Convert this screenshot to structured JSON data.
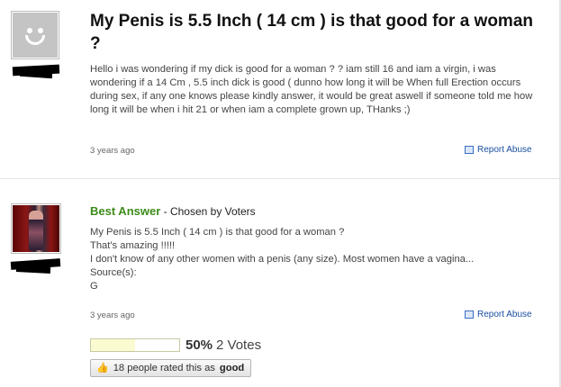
{
  "question": {
    "title": "My Penis is 5.5 Inch ( 14 cm ) is that good for a woman ?",
    "body": "Hello i was wondering if my dick is good for a woman ? ? iam still 16 and iam a virgin, i was wondering if a 14 Cm , 5.5 inch dick is good ( dunno how long it will be When full Erection occurs during sex, if any one knows please kindly answer, it would be great aswell if someone told me how long it will be when i hit 21 or when iam a complete grown up, THanks ;)",
    "time": "3 years ago",
    "report_label": "Report Abuse",
    "avatar_icon": "default-user-icon"
  },
  "answer": {
    "badge": "Best Answer",
    "chosen_by": " - Chosen by Voters",
    "lines": [
      "My Penis is 5.5 Inch ( 14 cm ) is that good for a woman ?",
      "That's amazing !!!!!",
      "I don't know of any other women with a penis (any size). Most women have a vagina...",
      "Source(s):",
      "G"
    ],
    "time": "3 years ago",
    "report_label": "Report Abuse",
    "vote_fraction": 0.5,
    "vote_percent": "50%",
    "vote_count": "2 Votes",
    "rated_prefix": "18 people rated this as",
    "rated_value": "good"
  }
}
